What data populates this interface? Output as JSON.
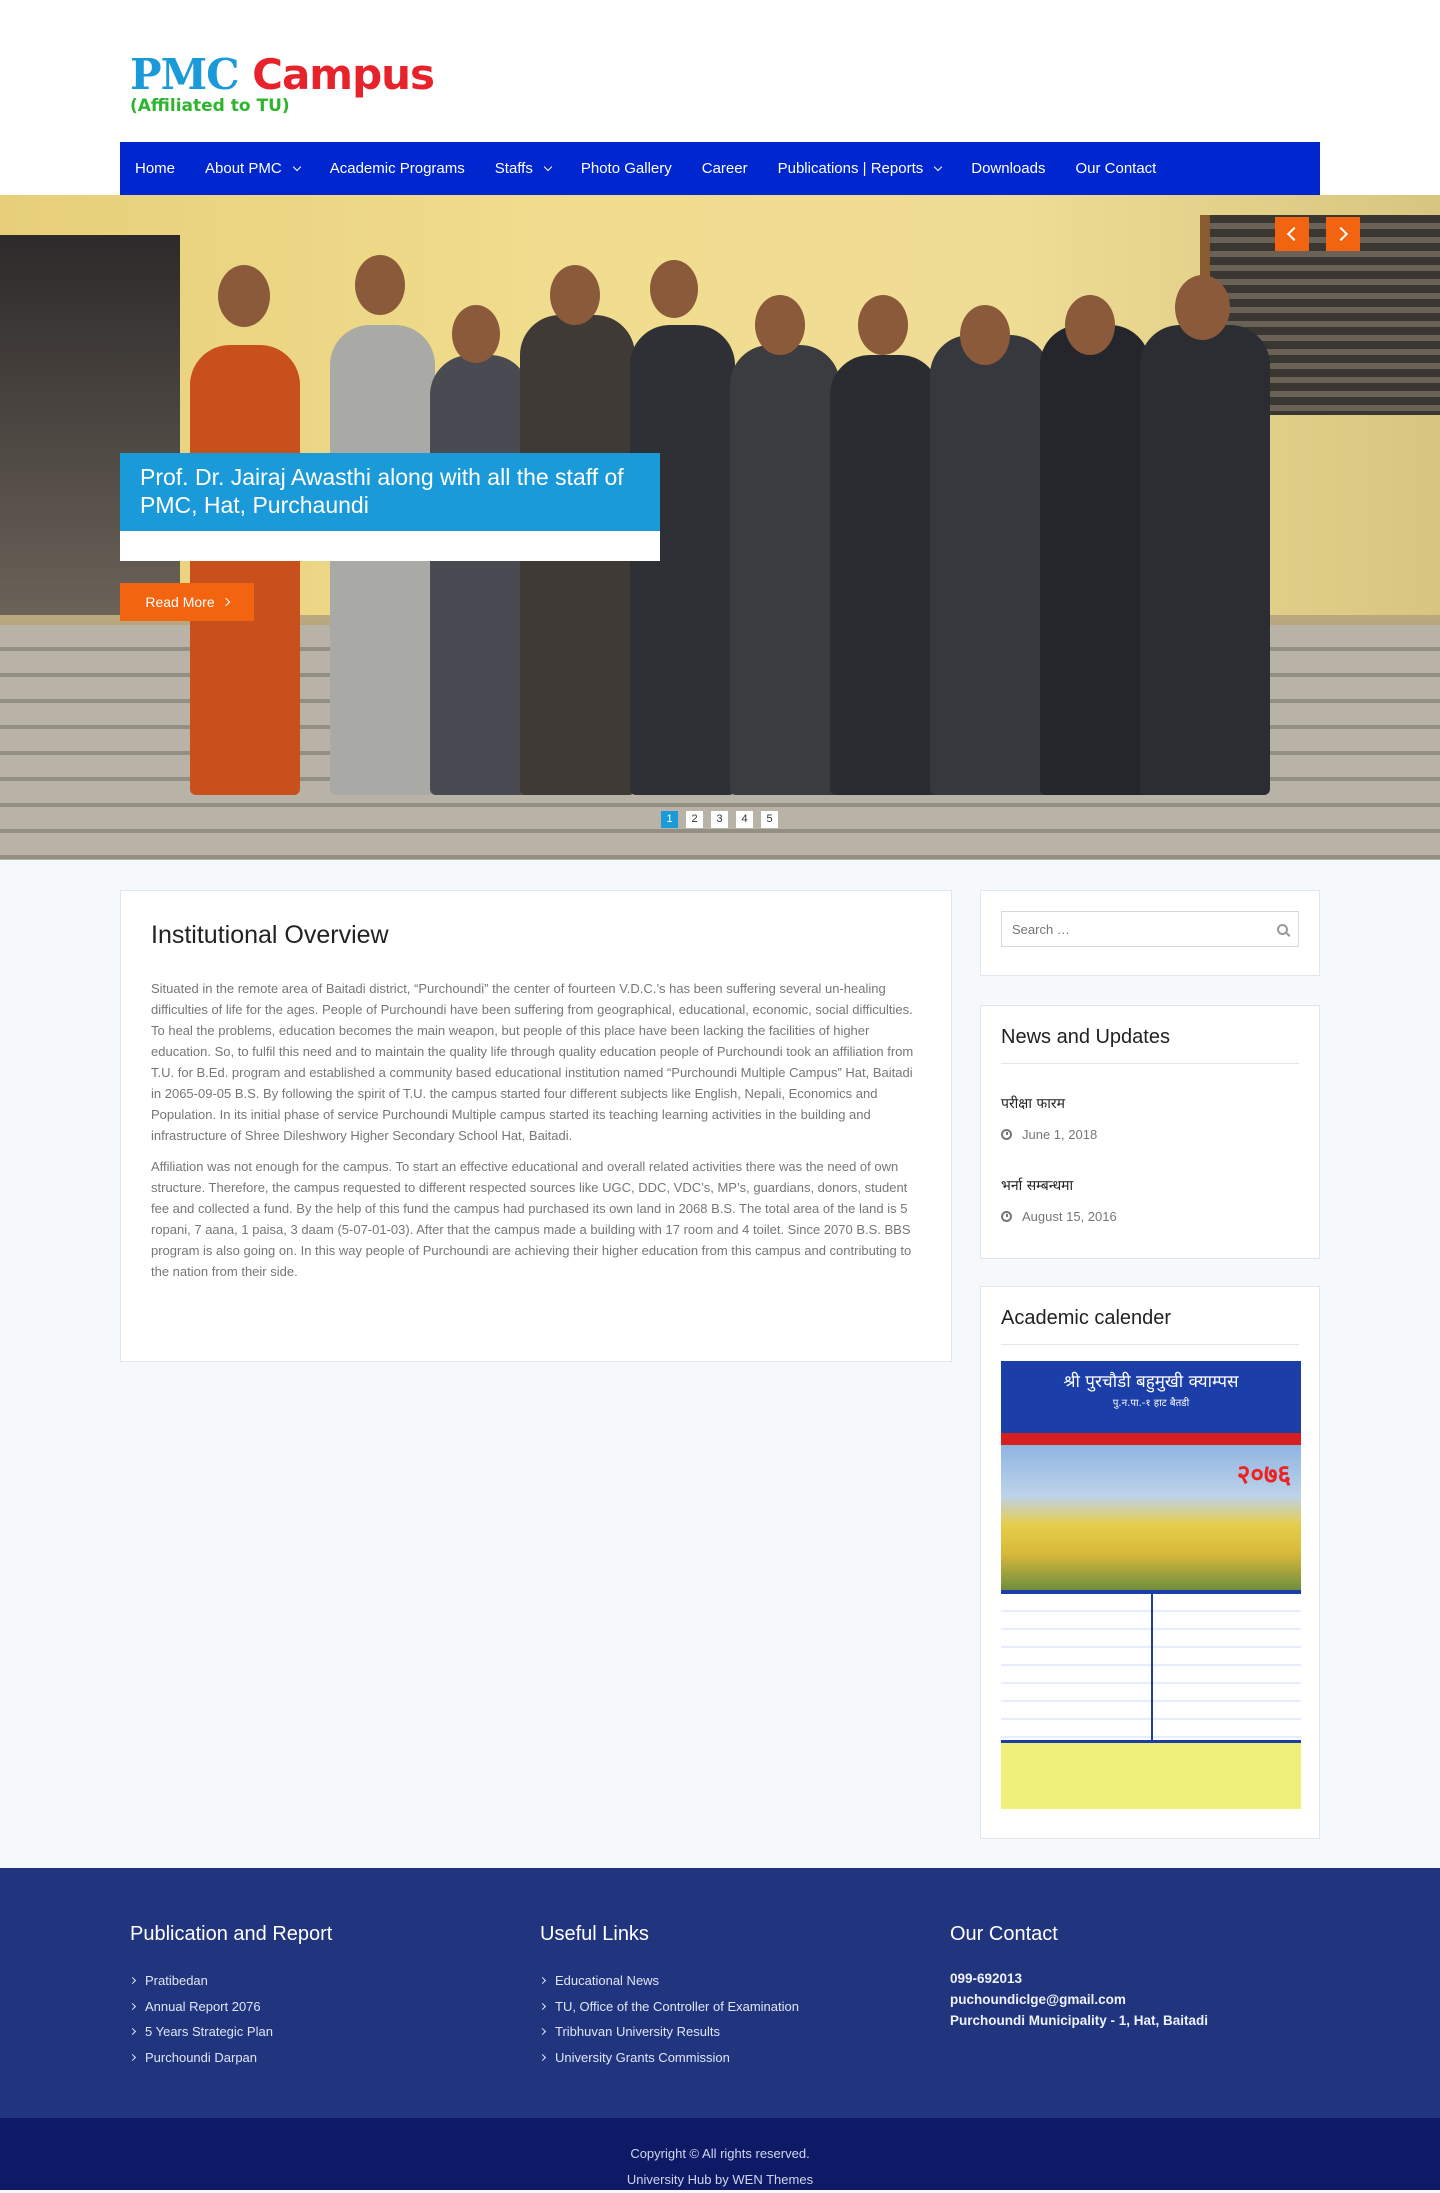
{
  "site": {
    "logo_main_1": "PMC",
    "logo_main_2": "Campus",
    "logo_sub": "(Affiliated to TU)"
  },
  "nav": {
    "items": [
      {
        "label": "Home"
      },
      {
        "label": "About PMC"
      },
      {
        "label": "Academic Programs"
      },
      {
        "label": "Staffs"
      },
      {
        "label": "Photo Gallery"
      },
      {
        "label": "Career"
      },
      {
        "label": "Publications | Reports"
      },
      {
        "label": "Downloads"
      },
      {
        "label": "Our Contact"
      }
    ]
  },
  "slider": {
    "caption": "Prof. Dr. Jairaj Awasthi along with all the staff of PMC, Hat, Purchaundi",
    "read_more": "Read More",
    "pages": [
      "1",
      "2",
      "3",
      "4",
      "5"
    ],
    "active_page": 1
  },
  "overview": {
    "title": "Institutional Overview",
    "para1": "Situated in the remote area of Baitadi district, “Purchoundi” the center of fourteen V.D.C.’s has been suffering several un-healing difficulties of life for the ages. People of Purchoundi have been suffering from geographical, educational, economic, social difficulties. To heal the problems, education becomes the main weapon, but people of this place have been lacking the facilities of higher education. So, to fulfil this need and to maintain the quality life through quality education people of Purchoundi took an affiliation from T.U. for B.Ed. program and established a community based educational institution named “Purchoundi Multiple Campus” Hat, Baitadi in 2065-09-05 B.S. By following the spirit of T.U. the campus started four different subjects like English, Nepali, Economics and Population. In its initial phase of service Purchoundi Multiple campus started its teaching learning activities in the building and infrastructure of Shree Dileshwory Higher Secondary School Hat, Baitadi.",
    "para2": "Affiliation was not enough for the campus. To start an effective educational and overall related activities there was the need of own structure. Therefore, the campus requested to different respected sources like UGC, DDC, VDC’s, MP’s, guardians, donors, student fee and collected a fund. By the help of this fund the campus had purchased its own land in 2068 B.S. The total area of the land is 5 ropani, 7 aana, 1 paisa, 3 daam (5-07-01-03). After that the campus made a building with 17 room and 4 toilet. Since 2070 B.S. BBS program is also going on. In this way people of Purchoundi are achieving their higher education from this campus and contributing to the nation from their side."
  },
  "search": {
    "placeholder": "Search …"
  },
  "news": {
    "title": "News and Updates",
    "items": [
      {
        "title": "परीक्षा फारम",
        "date": "June 1, 2018"
      },
      {
        "title": "भर्ना सम्बन्धमा",
        "date": "August 15, 2016"
      }
    ]
  },
  "calendar": {
    "title": "Academic calender",
    "image_heading": "श्री पुरचौडी बहुमुखी क्याम्पस",
    "image_sub": "पु.न.पा.-१ हाट बैतडी",
    "image_year": "२०७६"
  },
  "footer": {
    "publication": {
      "title": "Publication and Report",
      "links": [
        "Pratibedan",
        "Annual Report 2076",
        "5 Years Strategic Plan",
        "Purchoundi Darpan"
      ]
    },
    "useful": {
      "title": "Useful Links",
      "links": [
        "Educational News",
        "TU, Office of the Controller of Examination",
        "Tribhuvan University Results",
        "University Grants Commission"
      ]
    },
    "contact": {
      "title": "Our Contact",
      "phone": "099-692013",
      "email": "puchoundiclge@gmail.com",
      "address": "Purchoundi Municipality - 1, Hat, Baitadi"
    },
    "copyright": "Copyright © All rights reserved.",
    "credit": "University Hub by WEN Themes"
  },
  "colors": {
    "nav_bg": "#0027cf",
    "accent_orange": "#f2640f",
    "accent_blue": "#1b9ad9",
    "footer_bg": "#21357f",
    "bottom_bar_bg": "#0f1a66"
  }
}
